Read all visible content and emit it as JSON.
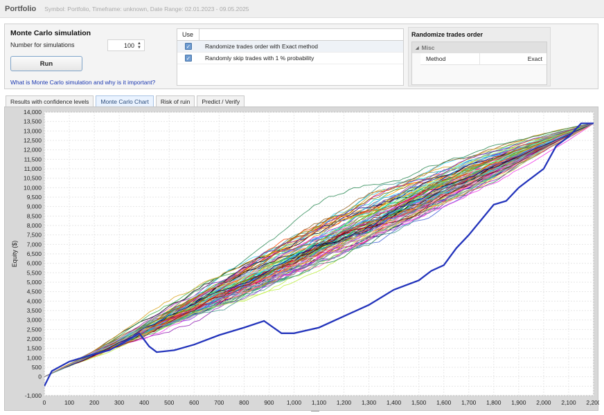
{
  "header": {
    "title": "Portfolio",
    "subtitle": "Symbol: Portfolio, Timeframe: unknown, Date Range: 02.01.2023 - 09.05.2025"
  },
  "simulation": {
    "title": "Monte Carlo simulation",
    "number_label": "Number for simulations",
    "number_value": "100",
    "run_label": "Run",
    "help_link": "What is Monte Carlo simulation and why is it important?"
  },
  "options": {
    "header": "Use",
    "rows": [
      {
        "checked": true,
        "label": "Randomize trades order with Exact method"
      },
      {
        "checked": true,
        "label": "Randomly skip trades with 1 % probability"
      }
    ]
  },
  "randomize_panel": {
    "title": "Randomize trades order",
    "category": "Misc",
    "property_key": "Method",
    "property_value": "Exact"
  },
  "tabs": [
    {
      "label": "Results with confidence levels",
      "active": false
    },
    {
      "label": "Monte Carlo Chart",
      "active": true
    },
    {
      "label": "Risk of ruin",
      "active": false
    },
    {
      "label": "Predict / Verify",
      "active": false
    }
  ],
  "colors": {
    "original_equity": "#2233bb",
    "checkbox": "#6d9bd1",
    "link": "#1a37b0"
  },
  "chart_data": {
    "type": "line",
    "title": "",
    "xlabel": "",
    "ylabel": "Equity ($)",
    "xlim": [
      0,
      2200
    ],
    "ylim": [
      -1000,
      14000
    ],
    "grid": true,
    "x_ticks": [
      "0",
      "100",
      "200",
      "300",
      "400",
      "500",
      "600",
      "700",
      "800",
      "900",
      "1,000",
      "1,100",
      "1,200",
      "1,300",
      "1,400",
      "1,500",
      "1,600",
      "1,700",
      "1,800",
      "1,900",
      "2,000",
      "2,100",
      "2,200"
    ],
    "y_ticks": [
      "-1,000",
      "0",
      "500",
      "1,000",
      "1,500",
      "2,000",
      "2,500",
      "3,000",
      "3,500",
      "4,000",
      "4,500",
      "5,000",
      "5,500",
      "6,000",
      "6,500",
      "7,000",
      "7,500",
      "8,000",
      "8,500",
      "9,000",
      "9,500",
      "10,000",
      "10,500",
      "11,000",
      "11,500",
      "12,000",
      "12,500",
      "13,000",
      "13,500",
      "14,000"
    ],
    "simulation_count": 100,
    "final_equity": 13400,
    "original_equity": {
      "x": [
        0,
        30,
        100,
        200,
        260,
        330,
        380,
        420,
        450,
        520,
        600,
        700,
        800,
        880,
        950,
        1000,
        1100,
        1200,
        1300,
        1400,
        1500,
        1550,
        1600,
        1650,
        1700,
        1800,
        1850,
        1900,
        2000,
        2050,
        2100,
        2150,
        2200
      ],
      "y": [
        -500,
        300,
        800,
        1200,
        1400,
        1900,
        2300,
        1600,
        1300,
        1400,
        1700,
        2200,
        2600,
        2950,
        2300,
        2300,
        2600,
        3200,
        3800,
        4600,
        5100,
        5600,
        5900,
        6800,
        7500,
        9100,
        9300,
        10000,
        11000,
        12200,
        12700,
        13400,
        13400
      ]
    }
  }
}
